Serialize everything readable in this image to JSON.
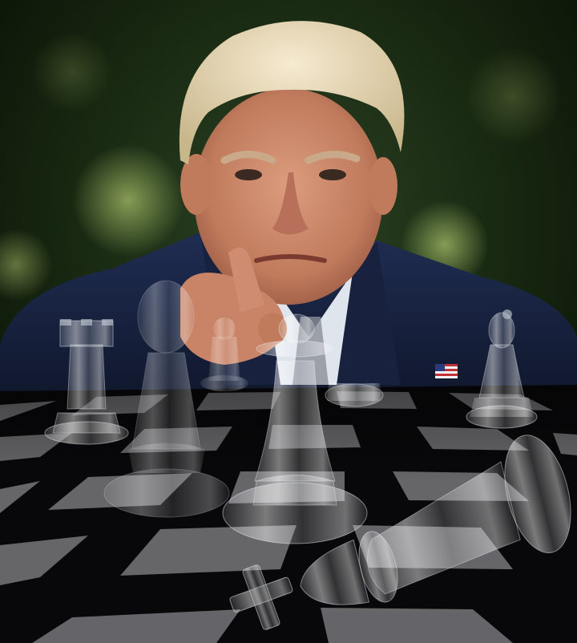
{
  "scene": {
    "palette": {
      "background_dark": "#0c160b",
      "background_mid": "#2c4424",
      "bokeh": "#8aa35a",
      "suit": "#1a2645",
      "shirt": "#dfe5ec",
      "skin": "#cf8f72",
      "hair": "#ecdcb2",
      "board_light": "#6e6e72",
      "board_dark": "#08080a",
      "glass": "#e6eef4"
    },
    "icons": {
      "flag_pin": "american-flag-pin-icon"
    }
  }
}
